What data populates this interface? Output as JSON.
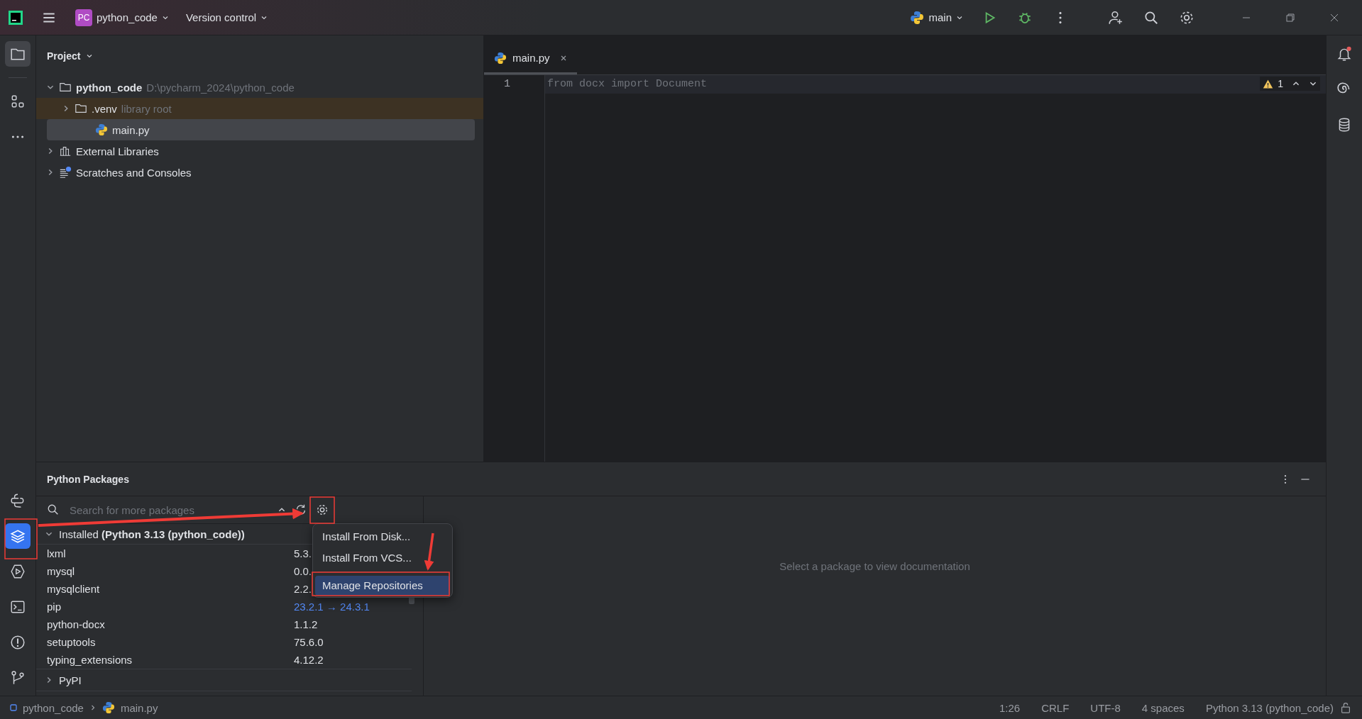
{
  "title_bar": {
    "project_badge": "PC",
    "project": "python_code",
    "vcs": "Version control",
    "run_config": "main"
  },
  "project_panel": {
    "title": "Project",
    "tree": [
      {
        "label": "python_code",
        "hint": "D:\\pycharm_2024\\python_code",
        "kind": "folder",
        "bold": true,
        "expanded": true,
        "selected": false,
        "highlighted": false,
        "children": [
          {
            "label": ".venv",
            "hint": "library root",
            "kind": "folder",
            "bold": false,
            "expanded": false,
            "selected": false,
            "highlighted": true
          },
          {
            "label": "main.py",
            "kind": "python",
            "bold": false,
            "selected": true,
            "highlighted": false
          }
        ]
      },
      {
        "label": "External Libraries",
        "kind": "library",
        "bold": false,
        "expanded": false,
        "selected": false,
        "highlighted": false
      },
      {
        "label": "Scratches and Consoles",
        "kind": "scratch",
        "bold": false,
        "expanded": false,
        "selected": false,
        "highlighted": false
      }
    ]
  },
  "editor": {
    "tabs": [
      {
        "label": "main.py",
        "selected": true
      }
    ],
    "lines": [
      {
        "number": "1",
        "code": "from docx import Document"
      }
    ],
    "warnings": "1"
  },
  "packages_panel": {
    "title": "Python Packages",
    "search": {
      "placeholder": "Search for more packages"
    },
    "installed_label": "Installed **(Python 3.13 (python_code))**",
    "installed_expanded": true,
    "packages": [
      {
        "name": "lxml",
        "version": "5.3.",
        "upgrade": false
      },
      {
        "name": "mysql",
        "version": "0.0.",
        "upgrade": false
      },
      {
        "name": "mysqlclient",
        "version": "2.2.",
        "upgrade": false
      },
      {
        "name": "pip",
        "version": "23.2.1 → 24.3.1",
        "upgrade": true
      },
      {
        "name": "python-docx",
        "version": "1.1.2",
        "upgrade": false
      },
      {
        "name": "setuptools",
        "version": "75.6.0",
        "upgrade": false
      },
      {
        "name": "typing_extensions",
        "version": "4.12.2",
        "upgrade": false
      }
    ],
    "pypi_label": "PyPI",
    "pypi_expanded": false,
    "menu": [
      {
        "label": "Install From Disk...",
        "selected": false
      },
      {
        "label": "Install From VCS...",
        "selected": false
      },
      {
        "label": "Manage Repositories",
        "selected": true
      }
    ],
    "doc_message": "Select a package to view documentation"
  },
  "status_bar": {
    "breadcrumbs": [
      "python_code",
      "main.py"
    ],
    "items": [
      "1:26",
      "CRLF",
      "UTF-8",
      "4 spaces",
      "Python 3.13 (python_code)"
    ]
  }
}
